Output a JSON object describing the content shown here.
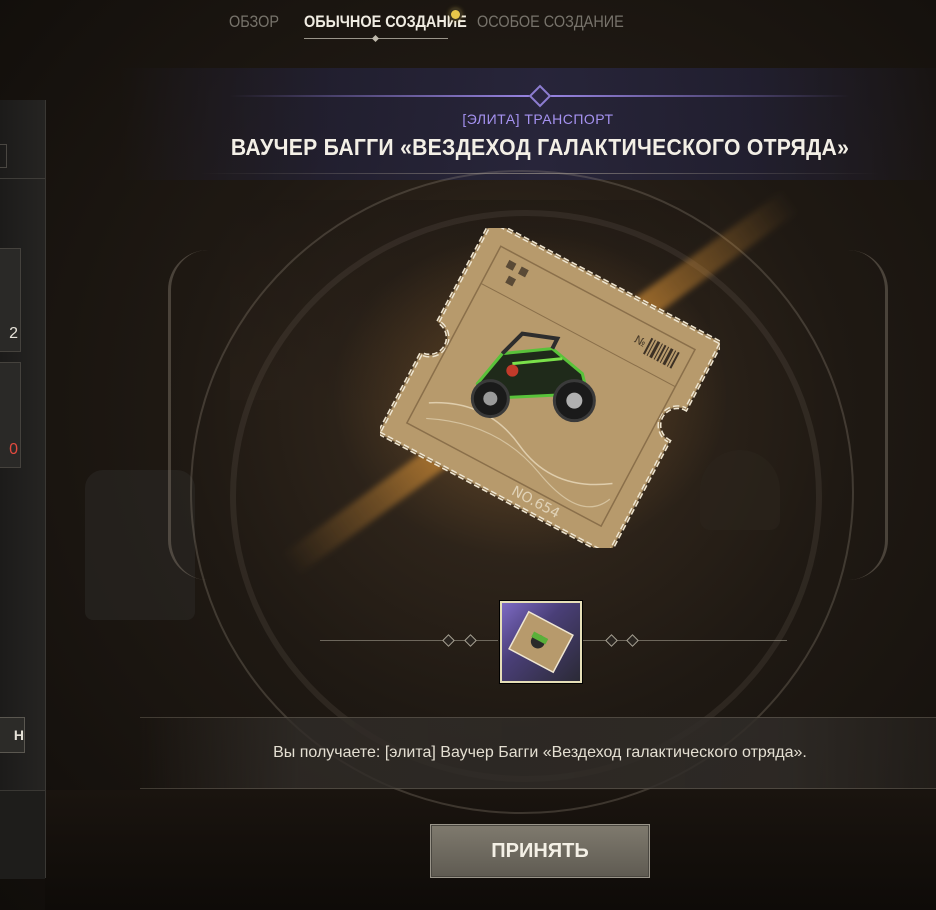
{
  "tabs": [
    {
      "label": "ОБЗОР"
    },
    {
      "label": "ОБЫЧНОЕ СОЗДАНИЕ"
    },
    {
      "label": "ОСОБОЕ СОЗДАНИЕ"
    }
  ],
  "sidebar": {
    "card1_value": "2",
    "card2_value": "0",
    "button_label": "Н"
  },
  "item": {
    "category": "[ЭЛИТА] ТРАНСПОРТ",
    "title": "ВАУЧЕР БАГГИ «ВЕЗДЕХОД ГАЛАКТИЧЕСКОГО ОТРЯДА»",
    "voucher_number_text": "NO.654",
    "voucher_no_mark": "№"
  },
  "receive_text": "Вы получаете: [элита] Ваучер Багги «Вездеход галактического отряда».",
  "accept_label": "ПРИНЯТЬ",
  "colors": {
    "category": "#a592f0",
    "accent_glow": "#ffaa3c",
    "notify_dot": "#e8c64a",
    "danger_number": "#e24a3e"
  }
}
